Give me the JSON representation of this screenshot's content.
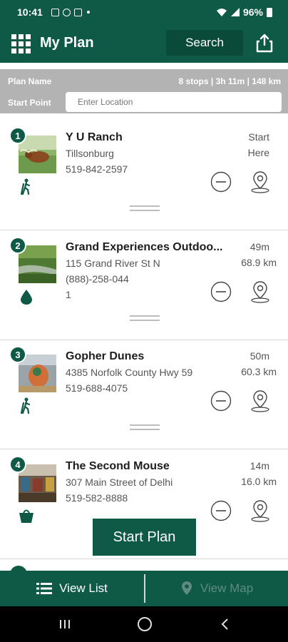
{
  "status_bar": {
    "time": "10:41",
    "battery": "96%"
  },
  "header": {
    "title": "My Plan",
    "search_label": "Search"
  },
  "plan": {
    "name_label": "Plan Name",
    "summary": "8 stops | 3h 11m | 148 km",
    "start_point_label": "Start Point",
    "location_placeholder": "Enter Location"
  },
  "stops": [
    {
      "number": "1",
      "name": "Y U Ranch",
      "address": "Tillsonburg",
      "phone": "519-842-2597",
      "extra": "",
      "time": "Start",
      "distance": "Here",
      "category": "hiker-icon"
    },
    {
      "number": "2",
      "name": "Grand Experiences Outdoo...",
      "address": "115 Grand River St N",
      "phone": "(888)-258-044",
      "extra": "1",
      "time": "49m",
      "distance": "68.9 km",
      "category": "water-drop-icon"
    },
    {
      "number": "3",
      "name": "Gopher Dunes",
      "address": "4385 Norfolk County Hwy 59",
      "phone": "519-688-4075",
      "extra": "",
      "time": "50m",
      "distance": "60.3 km",
      "category": "hiker-icon"
    },
    {
      "number": "4",
      "name": "The Second Mouse",
      "address": "307 Main Street of Delhi",
      "phone": "519-582-8888",
      "extra": "",
      "time": "14m",
      "distance": "16.0 km",
      "category": "shopping-basket-icon"
    }
  ],
  "actions": {
    "start_plan": "Start Plan"
  },
  "bottom_nav": {
    "list_label": "View List",
    "map_label": "View Map"
  },
  "colors": {
    "primary": "#0e5a46",
    "plan_bar": "#b3b3b3",
    "map_inactive": "#5e8b7e"
  }
}
